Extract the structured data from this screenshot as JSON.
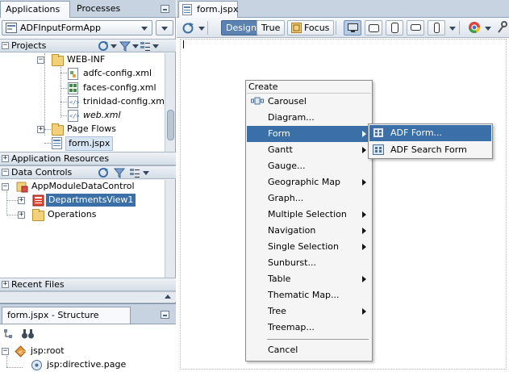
{
  "left_panel": {
    "tabs": [
      "Applications",
      "Processes"
    ],
    "app_selector": "ADFInputFormApp",
    "projects_label": "Projects",
    "project_tree": [
      {
        "label": "WEB-INF",
        "icon": "folder-icon"
      },
      {
        "label": "adfc-config.xml",
        "icon": "config-file-icon"
      },
      {
        "label": "faces-config.xml",
        "icon": "faces-config-icon"
      },
      {
        "label": "trinidad-config.xml",
        "icon": "xml-file-icon"
      },
      {
        "label": "web.xml",
        "icon": "xml-file-icon"
      },
      {
        "label": "Page Flows",
        "icon": "folder-icon"
      },
      {
        "label": "form.jspx",
        "icon": "jspx-file-icon"
      }
    ],
    "application_resources_label": "Application Resources",
    "data_controls_label": "Data Controls",
    "data_controls_tree": [
      {
        "label": "AppModuleDataControl",
        "icon": "data-control-icon"
      },
      {
        "label": "DepartmentsView1",
        "icon": "view-object-icon"
      },
      {
        "label": "Operations",
        "icon": "folder-icon"
      }
    ],
    "recent_files_label": "Recent Files"
  },
  "structure_panel": {
    "title": "form.jspx - Structure",
    "tree": [
      {
        "label": "jsp:root",
        "icon": "jsp-root-icon"
      },
      {
        "label": "jsp:directive.page",
        "icon": "directive-icon"
      }
    ]
  },
  "editor": {
    "tab_label": "form.jspx",
    "toolbar": {
      "design_label": "Design",
      "true_label": "True",
      "focus_label": "Focus"
    }
  },
  "context_menu": {
    "title": "Create",
    "items": [
      {
        "label": "Carousel",
        "has_submenu": false
      },
      {
        "label": "Diagram...",
        "has_submenu": false
      },
      {
        "label": "Form",
        "has_submenu": true,
        "active": true
      },
      {
        "label": "Gantt",
        "has_submenu": true
      },
      {
        "label": "Gauge...",
        "has_submenu": false
      },
      {
        "label": "Geographic Map",
        "has_submenu": true
      },
      {
        "label": "Graph...",
        "has_submenu": false
      },
      {
        "label": "Multiple Selection",
        "has_submenu": true
      },
      {
        "label": "Navigation",
        "has_submenu": true
      },
      {
        "label": "Single Selection",
        "has_submenu": true
      },
      {
        "label": "Sunburst...",
        "has_submenu": false
      },
      {
        "label": "Table",
        "has_submenu": true
      },
      {
        "label": "Thematic Map...",
        "has_submenu": false
      },
      {
        "label": "Tree",
        "has_submenu": true
      },
      {
        "label": "Treemap...",
        "has_submenu": false
      }
    ],
    "cancel_label": "Cancel"
  },
  "submenu": {
    "items": [
      {
        "label": "ADF Form...",
        "active": true
      },
      {
        "label": "ADF Search Form",
        "active": false
      }
    ]
  },
  "colors": {
    "selection_blue": "#3a6fa7",
    "pane_header": "#c7d3e0",
    "pressed_button": "#5b82b0"
  }
}
